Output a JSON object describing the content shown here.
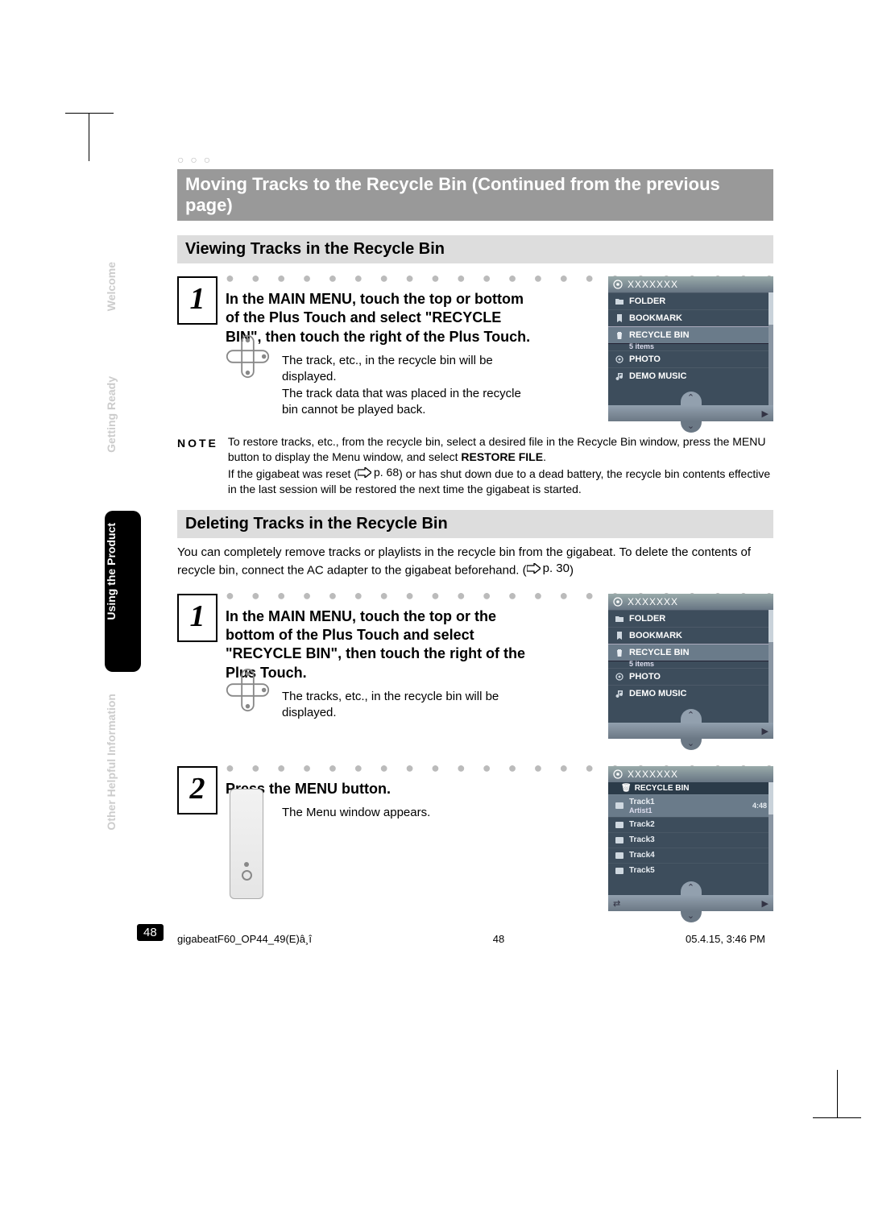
{
  "page": {
    "ornament": "○ ○ ○",
    "title": "Moving Tracks to the Recycle Bin (Continued from the previous page)",
    "number": "48"
  },
  "sidebar": {
    "tabs": [
      "Welcome",
      "Getting Ready",
      "Using the Product",
      "Other Helpful Information"
    ],
    "active_index": 2
  },
  "sectionA": {
    "heading": "Viewing Tracks in the Recycle Bin",
    "step1_title": "In the MAIN MENU, touch the top or bottom of the Plus Touch and select \"RECYCLE BIN\", then touch the right of the Plus Touch.",
    "step1_desc1": "The track, etc., in the recycle bin will be displayed.",
    "step1_desc2": "The track data that was placed in the recycle bin cannot be played back.",
    "note_label": "NOTE",
    "note_p1a": "To restore tracks, etc., from the recycle bin, select a desired file in the Recycle Bin window, press the MENU button to display the Menu window, and select ",
    "note_p1_bold": "RESTORE FILE",
    "note_p1b": ".",
    "note_p2a": "If the gigabeat was reset (",
    "note_p2_ref": "p. 68",
    "note_p2b": ") or has shut down due to a dead battery, the recycle bin contents effective in the last session will be restored the next time the gigabeat is started."
  },
  "sectionB": {
    "heading": "Deleting Tracks in the Recycle Bin",
    "intro_a": "You can completely remove tracks or playlists in the recycle bin from the gigabeat. To delete the contents of recycle bin, connect the AC adapter to the gigabeat beforehand. (",
    "intro_ref": "p. 30",
    "intro_b": ")",
    "step1_title": "In the MAIN MENU, touch the top or the bottom of the Plus Touch and select \"RECYCLE BIN\", then touch the right of the Plus Touch.",
    "step1_desc": "The tracks, etc., in the recycle bin will be displayed.",
    "step2_title": "Press the MENU button.",
    "step2_desc": "The Menu window appears."
  },
  "screens": {
    "title_placeholder": "XXXXXXX",
    "menu": {
      "items": [
        {
          "icon": "folder",
          "label": "FOLDER"
        },
        {
          "icon": "bookmark",
          "label": "BOOKMARK"
        },
        {
          "icon": "trash",
          "label": "RECYCLE BIN",
          "sub": "5 items",
          "selected": true
        },
        {
          "icon": "photo",
          "label": "PHOTO"
        },
        {
          "icon": "music",
          "label": "DEMO MUSIC"
        }
      ]
    },
    "tracks": {
      "header": "RECYCLE BIN",
      "items": [
        {
          "label": "Track1",
          "sub": "Artist1",
          "dur": "4:48",
          "selected": true
        },
        {
          "label": "Track2"
        },
        {
          "label": "Track3"
        },
        {
          "label": "Track4"
        },
        {
          "label": "Track5"
        }
      ]
    }
  },
  "footer": {
    "file": "gigabeatF60_OP44_49(E)â¸î",
    "page": "48",
    "timestamp": "05.4.15, 3:46 PM"
  }
}
